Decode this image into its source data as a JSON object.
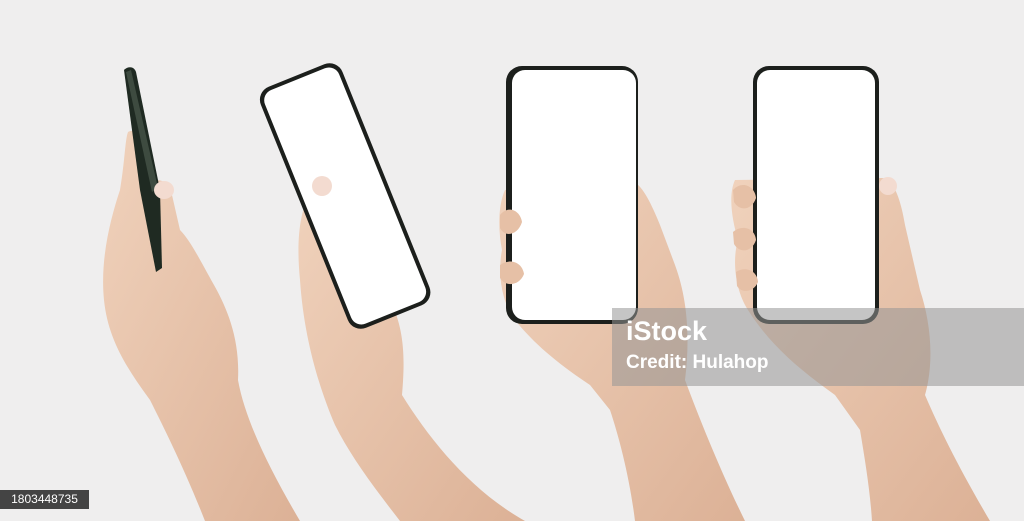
{
  "watermark": {
    "brand": "iStock",
    "credit": "Credit: Hulahop"
  },
  "stock_id": "1803448735",
  "colors": {
    "background": "#efeeee",
    "skin": "#eccbb2",
    "skin_shadow": "#d9ae93",
    "phone_frame": "#1c1f1c",
    "screen": "#ffffff"
  }
}
